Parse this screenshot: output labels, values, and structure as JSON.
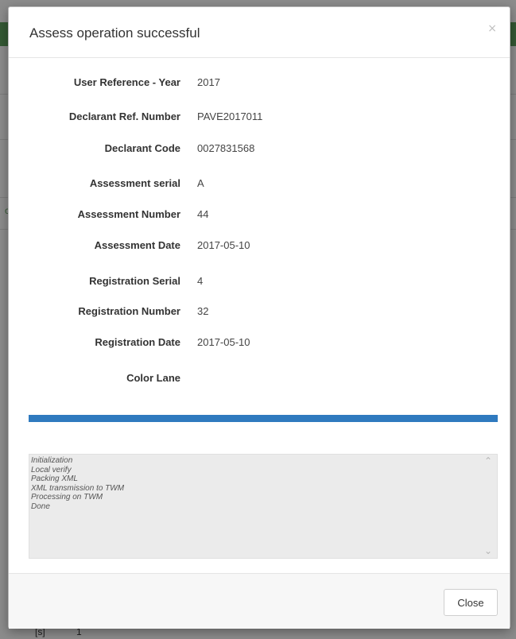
{
  "background": {
    "side_text": "c",
    "bottom_cells": [
      "[s]",
      "1"
    ]
  },
  "modal": {
    "title": "Assess operation successful",
    "close_icon": "×",
    "fields": [
      {
        "label": "User Reference - Year",
        "value": "2017"
      },
      {
        "label": "Declarant Ref. Number",
        "value": "PAVE2017011"
      },
      {
        "label": "Declarant Code",
        "value": "0027831568"
      },
      {
        "label": "Assessment serial",
        "value": "A"
      },
      {
        "label": "Assessment Number",
        "value": "44"
      },
      {
        "label": "Assessment Date",
        "value": "2017-05-10"
      },
      {
        "label": "Registration Serial",
        "value": "4"
      },
      {
        "label": "Registration Number",
        "value": "32"
      },
      {
        "label": "Registration Date",
        "value": "2017-05-10"
      },
      {
        "label": "Color Lane",
        "value": ""
      }
    ],
    "progress": 1.0,
    "progress_color": "#2f7abf",
    "log_lines": [
      "Initialization",
      "Local verify",
      "Packing XML",
      "XML transmission to TWM",
      "Processing on TWM",
      "Done"
    ],
    "scroll_up_icon": "chevron-up-icon",
    "scroll_down_icon": "chevron-down-icon",
    "close_button_label": "Close"
  }
}
